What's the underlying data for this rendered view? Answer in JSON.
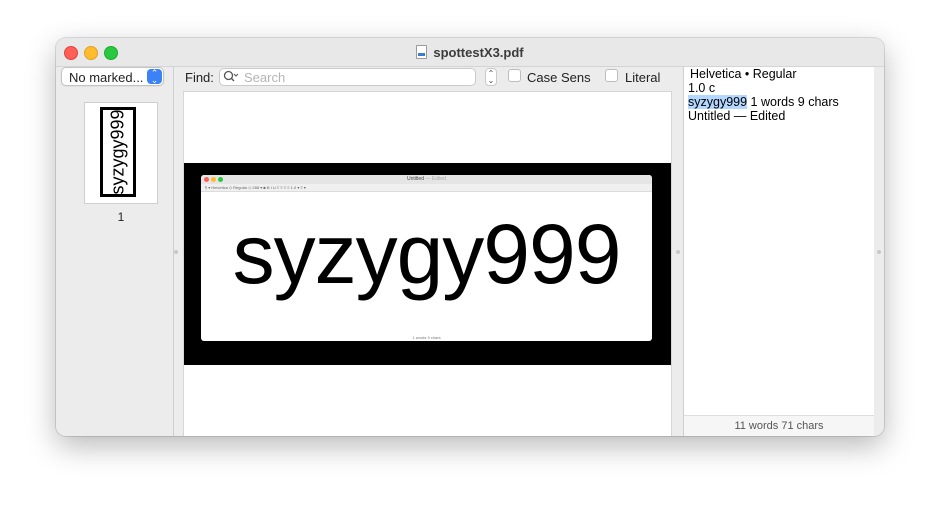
{
  "window": {
    "title": "spottestX3.pdf"
  },
  "sidebar": {
    "popup_label": "No marked...",
    "thumbnail_text": "syzygy999",
    "page_number": "1"
  },
  "findbar": {
    "label": "Find:",
    "search_placeholder": "Search",
    "case_sensitive_label": "Case Sens",
    "literal_label": "Literal"
  },
  "page": {
    "text": "syzygy999",
    "inner_title": "Untitled",
    "inner_title_suffix": "— Edited",
    "inner_status": "1 words 9 chars",
    "inner_toolbar": "¶ ▾   Helvetica   ◇  Regular  ◇  288 ▾   ■   B  I  U   ≡  ≡  ≡  ≡   1.0 ▾   ≡ ▾"
  },
  "info_pane": {
    "lines": [
      "Helvetica • Regular",
      "1.0 c",
      "syzygy999",
      "1 words 9 chars",
      "Untitled — Edited"
    ],
    "footer": "11  words  71  chars"
  },
  "colors": {
    "close": "#fe5f57",
    "minimize": "#febc2e",
    "maximize": "#28c840",
    "accent": "#3b82f6",
    "selection": "#b3d7ff"
  }
}
